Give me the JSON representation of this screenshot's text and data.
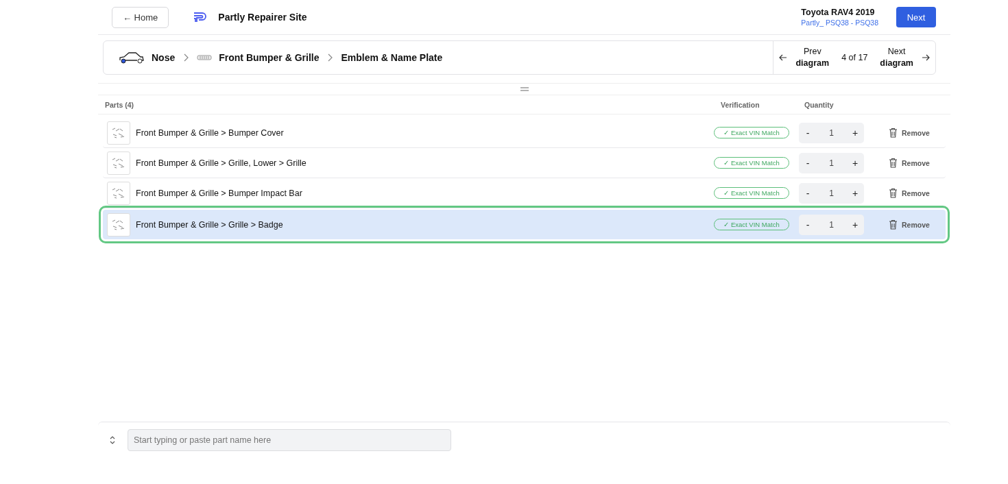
{
  "header": {
    "back_button": "← Home",
    "site_title": "Partly Repairer Site",
    "vehicle": "Toyota RAV4 2019",
    "vehicle_code": "Partly_ PSQ38 - PSQ38",
    "next_button": "Next"
  },
  "breadcrumb": [
    {
      "label": "Nose",
      "kind": "car"
    },
    {
      "label": "Front Bumper & Grille",
      "kind": "bumper"
    },
    {
      "label": "Emblem & Name Plate",
      "kind": "none"
    }
  ],
  "diagram_nav": {
    "prev": [
      "Prev",
      "diagram"
    ],
    "position": "4 of 17",
    "next": [
      "Next",
      "diagram"
    ]
  },
  "table": {
    "columns": [
      "Parts (4)",
      "Verification",
      "Quantity"
    ],
    "rows": [
      {
        "name": "Front Bumper & Grille > Bumper Cover",
        "verification": "✓ Exact VIN Match",
        "quantity": "1",
        "minus": "-",
        "plus": "+",
        "remove": "Remove",
        "selected": false
      },
      {
        "name": "Front Bumper & Grille > Grille, Lower > Grille",
        "verification": "✓ Exact VIN Match",
        "quantity": "1",
        "minus": "-",
        "plus": "+",
        "remove": "Remove",
        "selected": false
      },
      {
        "name": "Front Bumper & Grille > Bumper Impact Bar",
        "verification": "✓ Exact VIN Match",
        "quantity": "1",
        "minus": "-",
        "plus": "+",
        "remove": "Remove",
        "selected": false
      },
      {
        "name": "Front Bumper & Grille > Grille > Badge",
        "verification": "✓ Exact VIN Match",
        "quantity": "1",
        "minus": "-",
        "plus": "+",
        "remove": "Remove",
        "selected": true
      }
    ]
  },
  "search": {
    "placeholder": "Start typing or paste part name here"
  }
}
